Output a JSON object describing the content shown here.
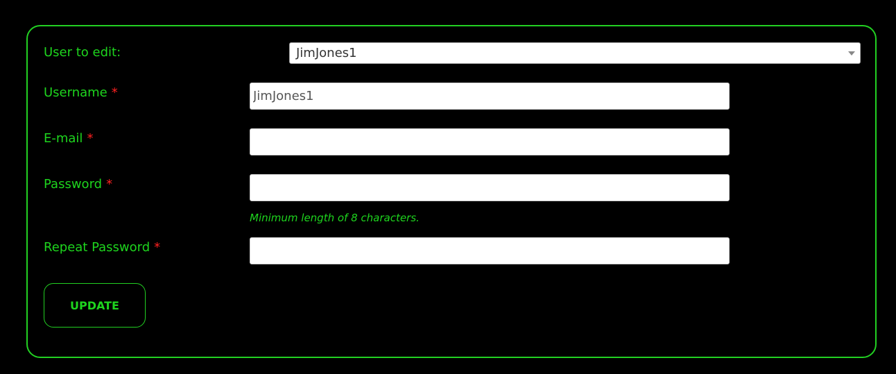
{
  "form": {
    "user_select": {
      "label": "User to edit:",
      "selected": "JimJones1"
    },
    "username": {
      "label": "Username",
      "required_mark": "*",
      "value": "JimJones1"
    },
    "email": {
      "label": "E-mail",
      "required_mark": "*",
      "value": ""
    },
    "password": {
      "label": "Password",
      "required_mark": "*",
      "value": "",
      "hint": "Minimum length of 8 characters."
    },
    "repeat_password": {
      "label": "Repeat Password",
      "required_mark": "*",
      "value": ""
    },
    "submit_label": "UPDATE"
  },
  "colors": {
    "accent": "#1ed51e",
    "required": "#ff2020",
    "background": "#000000"
  },
  "icons": {
    "select_arrow": "chevron-down-icon"
  }
}
